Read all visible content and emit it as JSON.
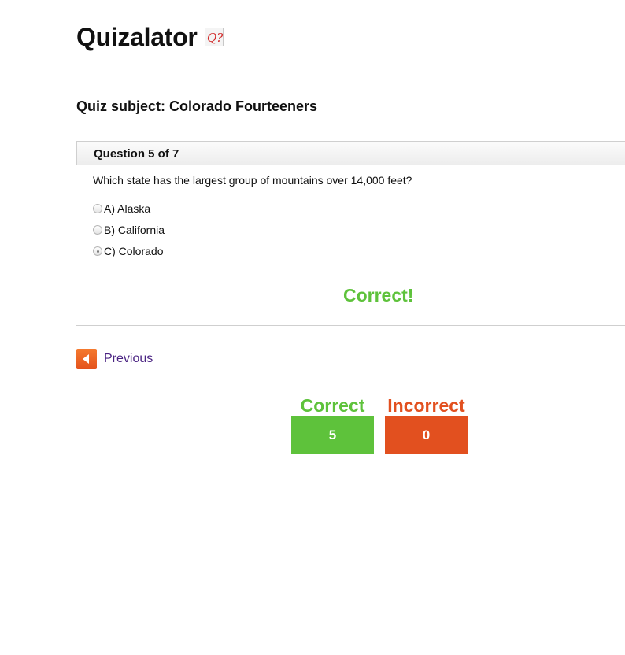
{
  "app": {
    "title": "Quizalator",
    "logo_icon": "q-question-icon",
    "logo_text": "Q?"
  },
  "quiz": {
    "subject": "Quiz subject: Colorado Fourteeners"
  },
  "question": {
    "header": "Question 5 of 7",
    "text": "Which state has the largest group of mountains over 14,000 feet?",
    "options": [
      {
        "label": "A) Alaska",
        "selected": false
      },
      {
        "label": "B) California",
        "selected": false
      },
      {
        "label": "C) Colorado",
        "selected": true
      }
    ],
    "result": "Correct!"
  },
  "navigation": {
    "previous_label": "Previous",
    "previous_icon": "arrow-left-icon"
  },
  "score": {
    "correct_label": "Correct",
    "correct_value": "5",
    "incorrect_label": "Incorrect",
    "incorrect_value": "0"
  },
  "colors": {
    "correct": "#5ec23b",
    "incorrect": "#e2501f",
    "link": "#4a2382"
  }
}
